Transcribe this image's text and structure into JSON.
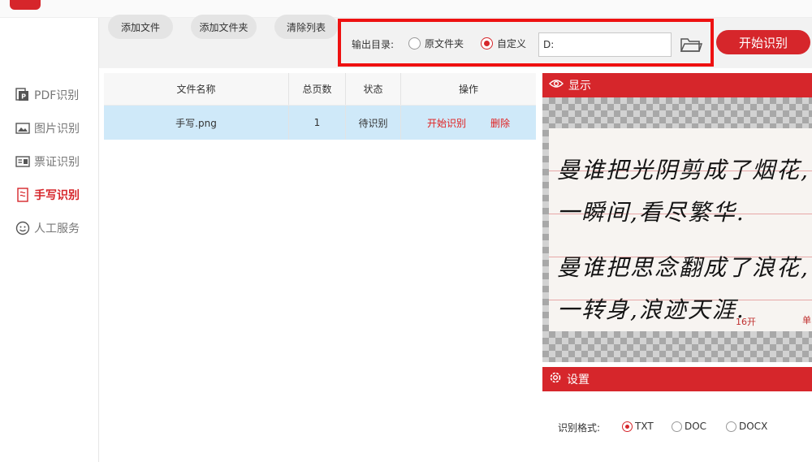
{
  "sidebar": {
    "items": [
      {
        "label": "PDF识别",
        "icon": "pdf-icon",
        "active": false
      },
      {
        "label": "图片识别",
        "icon": "image-icon",
        "active": false
      },
      {
        "label": "票证识别",
        "icon": "id-card-icon",
        "active": false
      },
      {
        "label": "手写识别",
        "icon": "handwriting-icon",
        "active": true
      },
      {
        "label": "人工服务",
        "icon": "smiley-icon",
        "active": false
      }
    ]
  },
  "toolbar": {
    "add_file": "添加文件",
    "add_folder": "添加文件夹",
    "clear_list": "清除列表",
    "output_label": "输出目录:",
    "output_options": [
      {
        "label": "原文件夹",
        "selected": false
      },
      {
        "label": "自定义",
        "selected": true
      }
    ],
    "output_path": "D:",
    "start_label": "开始识别"
  },
  "table": {
    "columns": [
      "文件名称",
      "总页数",
      "状态",
      "操作"
    ],
    "rows": [
      {
        "name": "手写.png",
        "pages": "1",
        "status": "待识别",
        "actions": [
          "开始识别",
          "删除"
        ]
      }
    ]
  },
  "preview": {
    "title": "显示",
    "lines": [
      "曼谁把光阴剪成了烟花,",
      "一瞬间,看尽繁华.",
      "曼谁把思念翻成了浪花,",
      "一转身,浪迹天涯."
    ],
    "paper_mark": "16开",
    "paper_mark_right": "单"
  },
  "settings": {
    "title": "设置",
    "format_label": "识别格式:",
    "formats": [
      {
        "label": "TXT",
        "selected": true
      },
      {
        "label": "DOC",
        "selected": false
      },
      {
        "label": "DOCX",
        "selected": false
      }
    ]
  },
  "colors": {
    "accent": "#d6262b",
    "highlight_row": "#cfe9f9",
    "toolbar_bg": "#f2f2f2"
  }
}
